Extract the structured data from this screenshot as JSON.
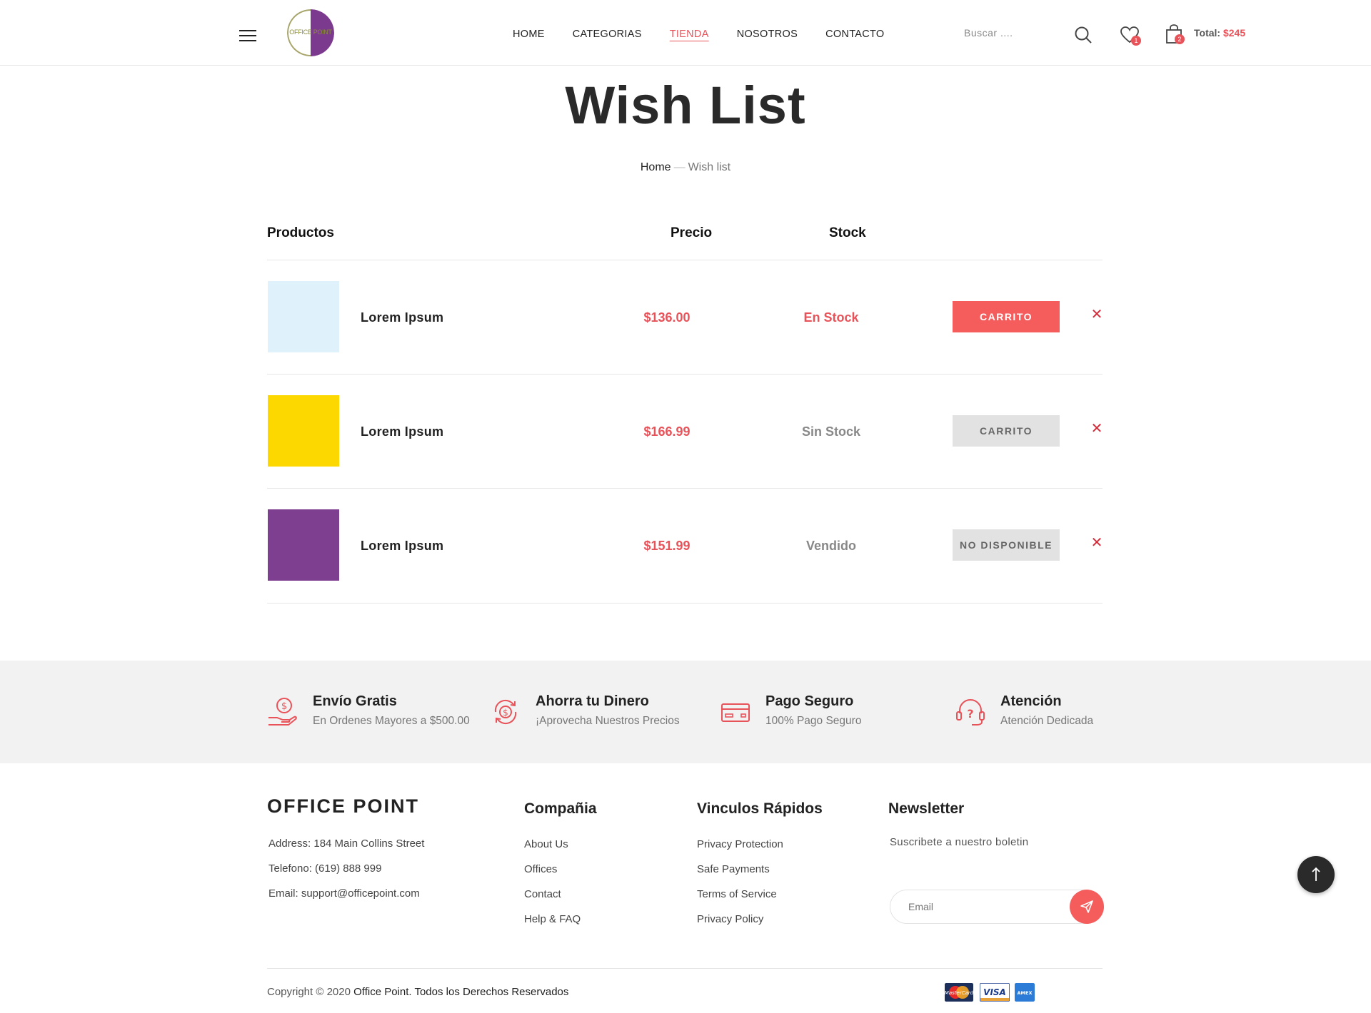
{
  "header": {
    "logo_text": "OFFICE POINT",
    "nav": [
      "HOME",
      "CATEGORIAS",
      "TIENDA",
      "NOSOTROS",
      "CONTACTO"
    ],
    "active_nav": "TIENDA",
    "search_placeholder": "Buscar ....",
    "wishlist_count": "1",
    "cart_count": "2",
    "total_label": "Total:",
    "total_amount": "$245"
  },
  "page": {
    "title": "Wish List",
    "breadcrumb_home": "Home",
    "breadcrumb_sep": "—",
    "breadcrumb_current": "Wish list"
  },
  "table": {
    "headers": {
      "products": "Productos",
      "price": "Precio",
      "stock": "Stock"
    },
    "rows": [
      {
        "name": "Lorem Ipsum",
        "price": "$136.00",
        "stock": "En Stock",
        "button": "CARRITO",
        "color": "#dff1fb",
        "remove": "✕"
      },
      {
        "name": "Lorem Ipsum",
        "price": "$166.99",
        "stock": "Sin Stock",
        "button": "CARRITO",
        "color": "#fdd800",
        "remove": "✕"
      },
      {
        "name": "Lorem Ipsum",
        "price": "$151.99",
        "stock": "Vendido",
        "button": "NO DISPONIBLE",
        "color": "#7f3f90",
        "remove": "✕"
      }
    ]
  },
  "features": [
    {
      "title": "Envío Gratis",
      "subtitle": "En Ordenes Mayores a $500.00",
      "icon": "hand-dollar-icon"
    },
    {
      "title": "Ahorra tu Dinero",
      "subtitle": "¡Aprovecha Nuestros Precios",
      "icon": "money-cycle-icon"
    },
    {
      "title": "Pago Seguro",
      "subtitle": "100% Pago Seguro",
      "icon": "credit-card-icon"
    },
    {
      "title": "Atención",
      "subtitle": "Atención Dedicada",
      "icon": "headset-question-icon"
    }
  ],
  "footer": {
    "brand": "OFFICE POINT",
    "address": "Address: 184 Main Collins Street",
    "phone": "Telefono: (619) 888 999",
    "email": "Email: support@officepoint.com",
    "company_title": "Compañia",
    "company_links": [
      "About Us",
      "Offices",
      "Contact",
      "Help & FAQ"
    ],
    "quick_title": "Vinculos Rápidos",
    "quick_links": [
      "Privacy Protection",
      "Safe Payments",
      "Terms of Service",
      "Privacy Policy"
    ],
    "newsletter_title": "Newsletter",
    "newsletter_sub": "Suscribete a nuestro boletin",
    "email_placeholder": "Email",
    "copyright_prefix": "Copyright © 2020",
    "copyright_bold": "Office Point. Todos los Derechos Reservados",
    "payments": [
      "MasterCard",
      "VISA",
      "AMEX"
    ]
  },
  "colors": {
    "accent": "#f55d5d",
    "price": "#e8535a",
    "dark": "#222222"
  }
}
